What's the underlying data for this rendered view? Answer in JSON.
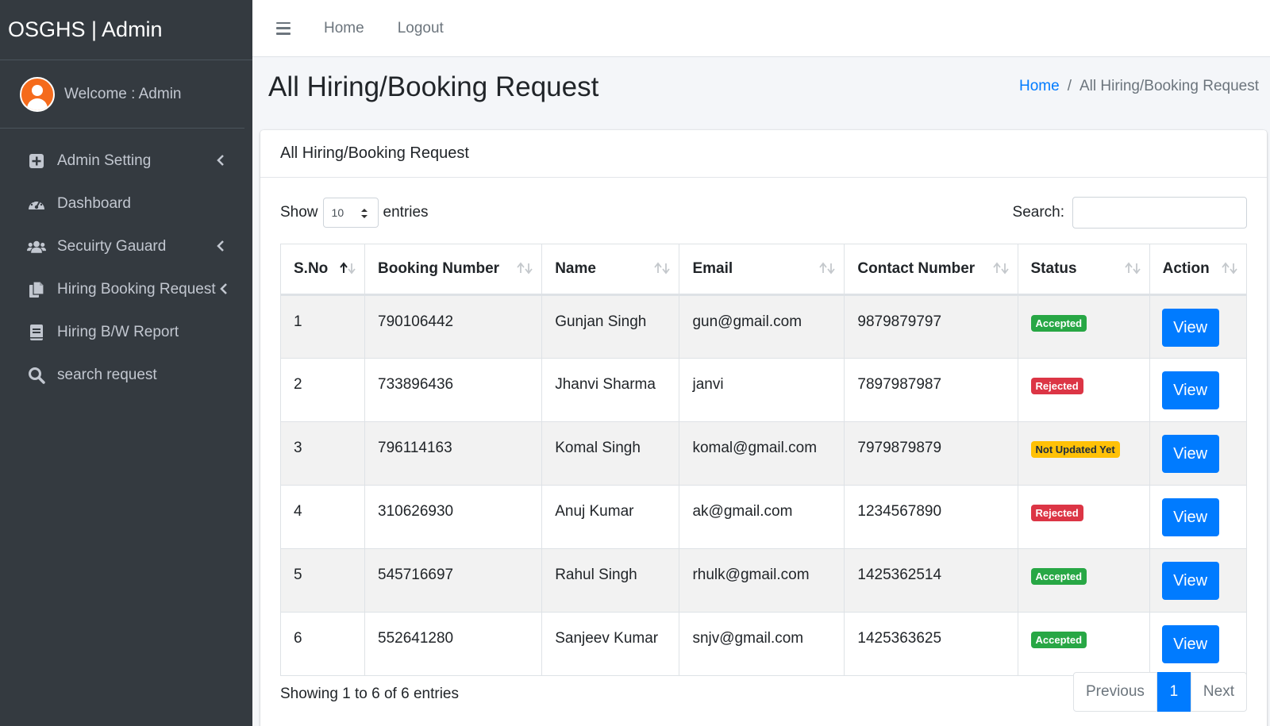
{
  "brand": {
    "name": "OSGHS | Admin"
  },
  "user": {
    "welcome": "Welcome : Admin"
  },
  "sidebar": {
    "items": [
      {
        "label": "Admin Setting",
        "icon": "plus-square-icon",
        "has_children": true
      },
      {
        "label": "Dashboard",
        "icon": "dashboard-gauge-icon",
        "has_children": false
      },
      {
        "label": "Secuirty Gauard",
        "icon": "users-icon",
        "has_children": true
      },
      {
        "label": "Hiring Booking Request",
        "icon": "file-copy-icon",
        "has_children": true
      },
      {
        "label": "Hiring B/W Report",
        "icon": "book-icon",
        "has_children": false
      },
      {
        "label": "search request",
        "icon": "search-icon",
        "has_children": false
      }
    ]
  },
  "topbar": {
    "home": "Home",
    "logout": "Logout"
  },
  "page": {
    "title": "All Hiring/Booking Request"
  },
  "breadcrumb": {
    "home": "Home",
    "separator": "/",
    "current": "All Hiring/Booking Request"
  },
  "card": {
    "title": "All Hiring/Booking Request"
  },
  "controls": {
    "show": "Show",
    "entries_value": "10",
    "entries": "entries",
    "search_label": "Search:"
  },
  "table": {
    "headers": [
      "S.No",
      "Booking Number",
      "Name",
      "Email",
      "Contact Number",
      "Status",
      "Action"
    ],
    "rows": [
      {
        "sno": "1",
        "booking": "790106442",
        "name": "Gunjan Singh",
        "email": "gun@gmail.com",
        "contact": "9879879797",
        "status": "Accepted",
        "action": "View"
      },
      {
        "sno": "2",
        "booking": "733896436",
        "name": "Jhanvi Sharma",
        "email": "janvi",
        "contact": "7897987987",
        "status": "Rejected",
        "action": "View"
      },
      {
        "sno": "3",
        "booking": "796114163",
        "name": "Komal Singh",
        "email": "komal@gmail.com",
        "contact": "7979879879",
        "status": "Not Updated Yet",
        "action": "View"
      },
      {
        "sno": "4",
        "booking": "310626930",
        "name": "Anuj Kumar",
        "email": "ak@gmail.com",
        "contact": "1234567890",
        "status": "Rejected",
        "action": "View"
      },
      {
        "sno": "5",
        "booking": "545716697",
        "name": "Rahul Singh",
        "email": "rhulk@gmail.com",
        "contact": "1425362514",
        "status": "Accepted",
        "action": "View"
      },
      {
        "sno": "6",
        "booking": "552641280",
        "name": "Sanjeev Kumar",
        "email": "snjv@gmail.com",
        "contact": "1425363625",
        "status": "Accepted",
        "action": "View"
      }
    ]
  },
  "status_colors": {
    "Accepted": "#28a745",
    "Rejected": "#dc3545",
    "Not Updated Yet": "#ffc107"
  },
  "footer": {
    "info": "Showing 1 to 6 of 6 entries",
    "previous": "Previous",
    "page": "1",
    "next": "Next"
  },
  "colors": {
    "sidebar_bg": "#343a40",
    "primary": "#007bff",
    "avatar": "#f56b1c"
  }
}
